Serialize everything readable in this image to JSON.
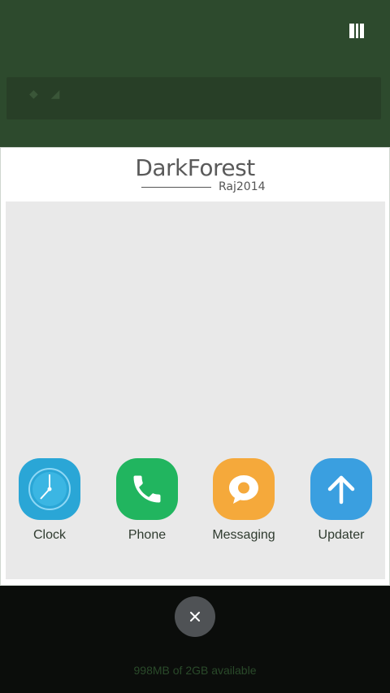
{
  "card": {
    "title": "DarkForest",
    "subtitle": "Raj2014"
  },
  "apps": [
    {
      "label": "Clock",
      "icon": "clock-icon",
      "color": "#2aa6d6"
    },
    {
      "label": "Phone",
      "icon": "phone-icon",
      "color": "#21b55f"
    },
    {
      "label": "Messaging",
      "icon": "message-bubble-icon",
      "color": "#f5a93b"
    },
    {
      "label": "Updater",
      "icon": "arrow-up-icon",
      "color": "#3a9fe0"
    }
  ],
  "memory_status": "998MB of 2GB available",
  "colors": {
    "theme_green": "#2d4a2d",
    "preview_bg": "#e9e9e9",
    "close_button": "#4f5255"
  },
  "icons": {
    "recents_toggle": "recents-layout-icon",
    "close": "close-icon"
  }
}
